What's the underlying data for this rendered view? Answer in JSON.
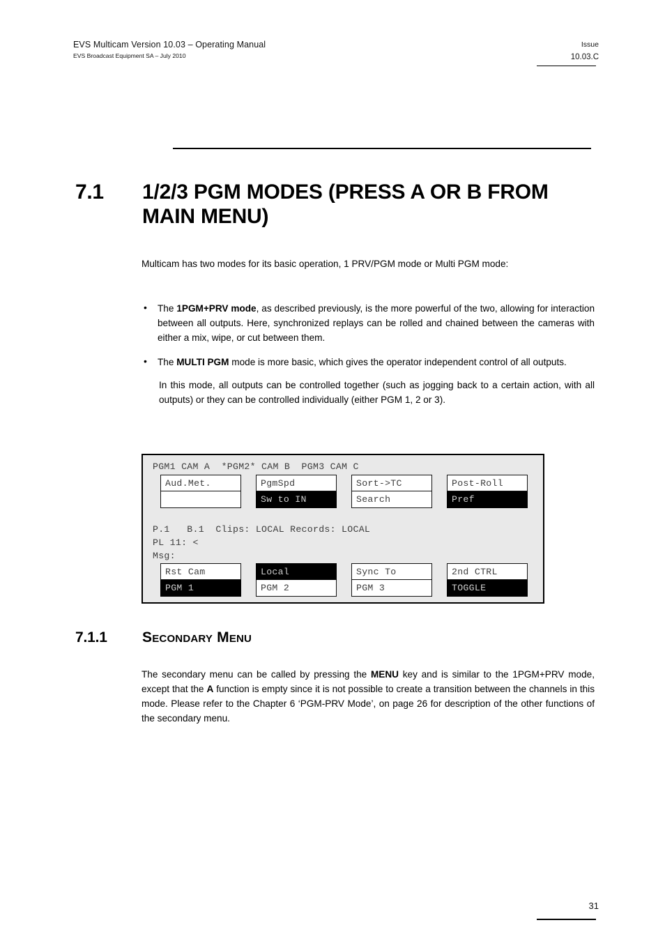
{
  "header": {
    "title": "EVS Multicam Version 10.03  – Operating Manual",
    "subtitle": "EVS Broadcast Equipment SA – July 2010",
    "issue_label": "Issue",
    "issue_value": "10.03.C"
  },
  "section": {
    "number": "7.1",
    "title": "1/2/3 PGM MODES (PRESS A OR B FROM MAIN MENU)"
  },
  "intro": {
    "paragraph": "Multicam has two modes for its basic operation, 1 PRV/PGM mode or Multi PGM mode:"
  },
  "bullets": [
    {
      "pre": "The ",
      "bold": "1PGM+PRV mode",
      "post": ", as described previously, is the more powerful of the two, allowing for interaction between all outputs. Here, synchronized replays can be rolled and chained between the cameras with either a mix, wipe, or cut between them."
    },
    {
      "pre": "The ",
      "bold": "MULTI PGM",
      "post": " mode is more basic, which gives the operator independent control of all outputs."
    }
  ],
  "sub_paragraph": "In this mode, all outputs can be controlled together (such as jogging back to a certain action, with all outputs) or they can be controlled individually (either PGM 1, 2 or 3).",
  "terminal": {
    "status_line_1": "PGM1 CAM A  *PGM2* CAM B  PGM3 CAM C",
    "status_line_2": "P.1   B.1  Clips: LOCAL Records: LOCAL",
    "status_line_3": "PL 11: <",
    "status_line_4": "Msg:",
    "top_row": [
      {
        "upper": "Aud.Met.",
        "upper_inverted": false,
        "lower": "",
        "lower_inverted": false
      },
      {
        "upper": "PgmSpd",
        "upper_inverted": false,
        "lower": "Sw to IN",
        "lower_inverted": true
      },
      {
        "upper": "Sort->TC",
        "upper_inverted": false,
        "lower": "Search",
        "lower_inverted": false
      },
      {
        "upper": "Post-Roll",
        "upper_inverted": false,
        "lower": "Pref",
        "lower_inverted": true
      }
    ],
    "bottom_row": [
      {
        "upper": "Rst Cam",
        "upper_inverted": false,
        "lower": "PGM 1",
        "lower_inverted": true
      },
      {
        "upper": "Local",
        "upper_inverted": true,
        "lower": "PGM 2",
        "lower_inverted": false
      },
      {
        "upper": "Sync To",
        "upper_inverted": false,
        "lower": "PGM 3",
        "lower_inverted": false
      },
      {
        "upper": "2nd CTRL",
        "upper_inverted": false,
        "lower": "TOGGLE",
        "lower_inverted": true
      }
    ]
  },
  "subsection": {
    "number": "7.1.1",
    "title": "Secondary Menu",
    "paragraph_parts": {
      "p1": "The secondary menu can be called by pressing the ",
      "b1": "MENU",
      "p2": " key and is similar to the 1PGM+PRV mode, except that the ",
      "b2": "A",
      "p3": " function is empty since it is not possible to create a transition between the channels in this mode. Please refer to the Chapter 6 ‘PGM-PRV Mode’, on page 26 for description of the other functions of the secondary menu."
    }
  },
  "footer": {
    "page_number": "31"
  },
  "colors": {
    "panel_background": "#e9e9e9",
    "cell_background": "#ffffff",
    "cell_inverted_background": "#000000",
    "cell_text": "#3d3d3d",
    "cell_inverted_text": "#cfcfcf"
  }
}
